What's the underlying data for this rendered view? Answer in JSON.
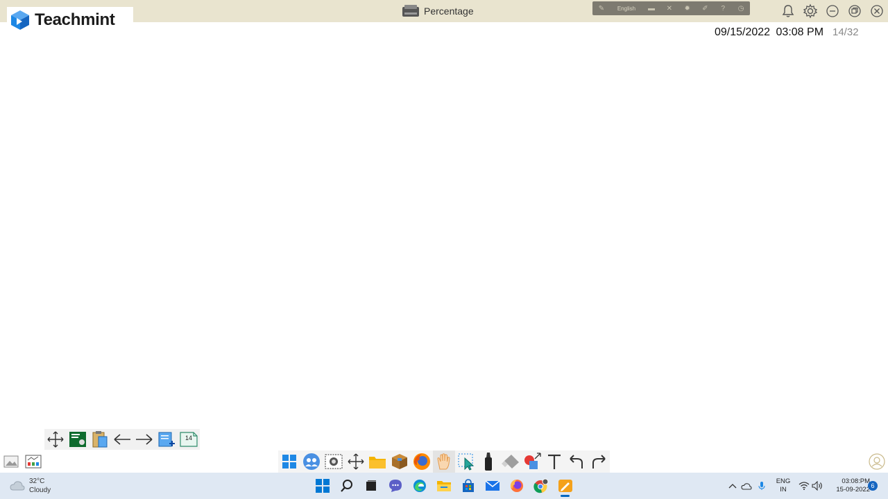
{
  "window": {
    "title": "Percentage",
    "language": "English"
  },
  "brand": {
    "name": "Teachmint"
  },
  "header": {
    "date": "09/15/2022",
    "time": "03:08 PM",
    "page_counter": "14/32"
  },
  "subtoolbar": {
    "page_number": "14"
  },
  "taskbar": {
    "weather": {
      "temperature": "32°C",
      "condition": "Cloudy"
    },
    "language": {
      "line1": "ENG",
      "line2": "IN"
    },
    "clock": {
      "time": "03:08:PM",
      "date": "15-09-2022"
    },
    "notification_count": "6"
  },
  "colors": {
    "titlebar": "#e9e4cf",
    "taskbar": "#dfe8f3",
    "brand_blue": "#1e88e5",
    "accent_orange": "#f4a11b"
  }
}
